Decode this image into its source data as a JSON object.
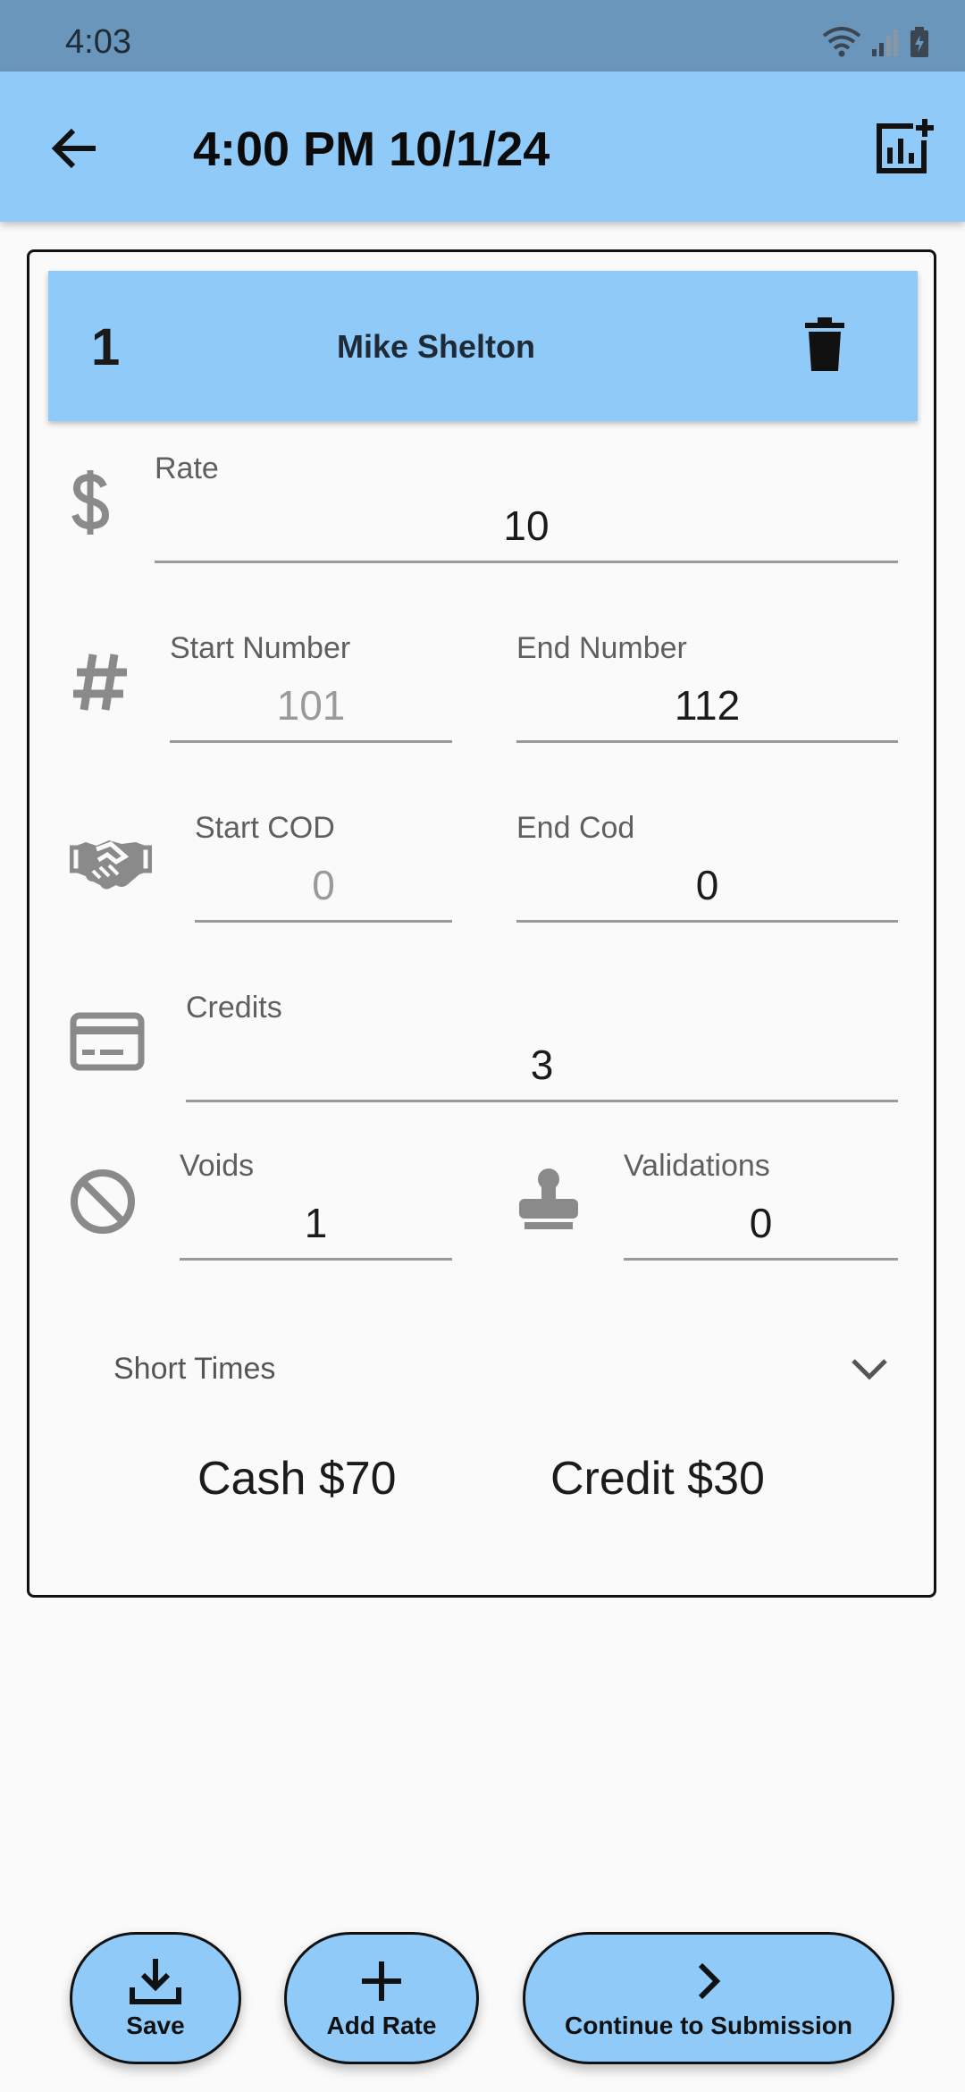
{
  "status_bar": {
    "time": "4:03"
  },
  "app_bar": {
    "title": "4:00 PM 10/1/24"
  },
  "card": {
    "index": "1",
    "employee_name": "Mike Shelton",
    "rate": {
      "label": "Rate",
      "value": "10"
    },
    "start_number": {
      "label": "Start Number",
      "value": "101"
    },
    "end_number": {
      "label": "End Number",
      "value": "112"
    },
    "start_cod": {
      "label": "Start COD",
      "value": "0"
    },
    "end_cod": {
      "label": "End Cod",
      "value": "0"
    },
    "credits": {
      "label": "Credits",
      "value": "3"
    },
    "voids": {
      "label": "Voids",
      "value": "1"
    },
    "validations": {
      "label": "Validations",
      "value": "0"
    },
    "short_times": {
      "label": "Short Times"
    },
    "totals": {
      "cash": "Cash $70",
      "credit": "Credit $30"
    }
  },
  "actions": {
    "save": "Save",
    "add_rate": "Add Rate",
    "continue": "Continue to Submission"
  },
  "icons": {
    "back": "arrow-left-icon",
    "report": "add-chart-icon",
    "delete": "trash-icon",
    "rate": "dollar-icon",
    "number": "hash-icon",
    "cod": "handshake-icon",
    "credits": "credit-card-icon",
    "voids": "block-icon",
    "validations": "stamp-icon",
    "expand": "chevron-down-icon",
    "save": "download-icon",
    "add": "plus-icon",
    "continue": "chevron-right-icon"
  },
  "colors": {
    "primary": "#90caf9",
    "status_bar": "#6b96bb",
    "background": "#fafafa"
  }
}
